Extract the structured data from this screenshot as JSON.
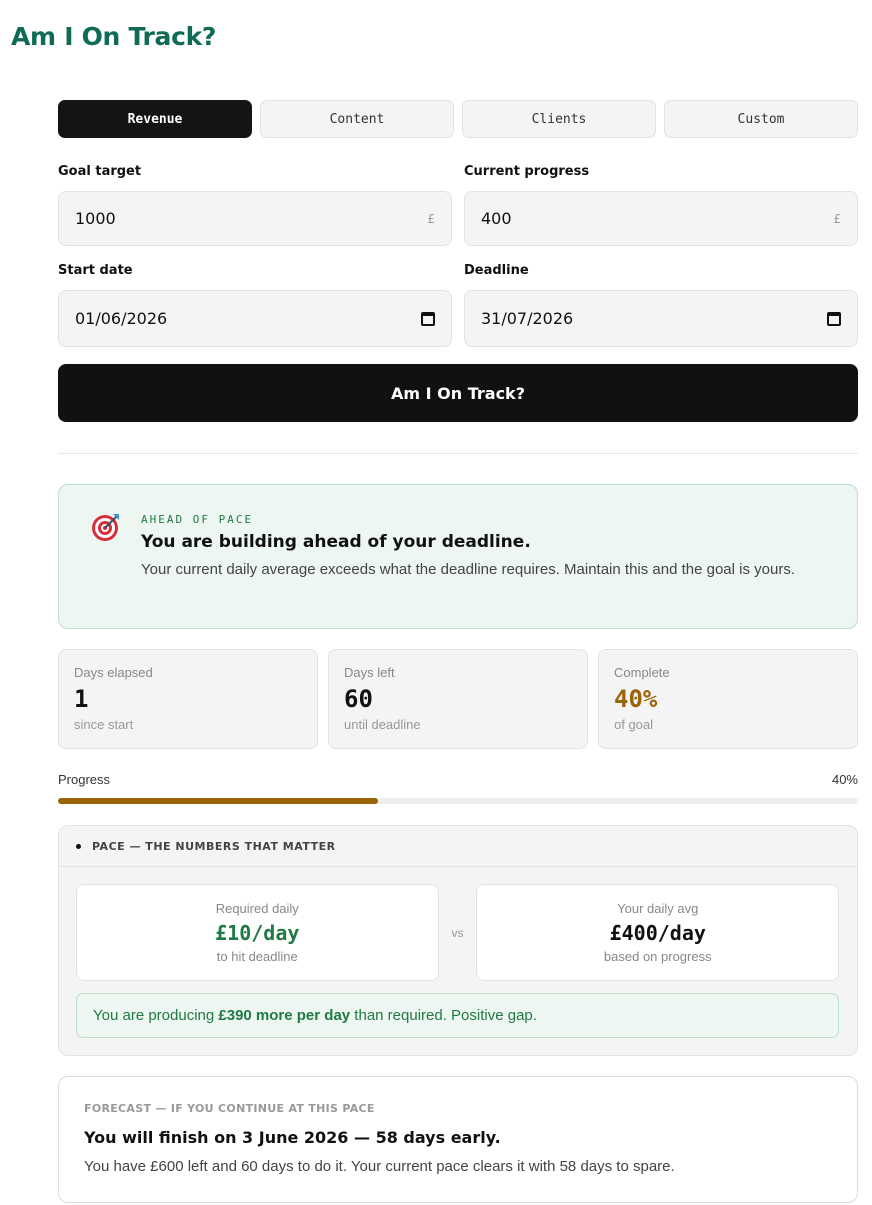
{
  "app": {
    "title": "Am I On Track?"
  },
  "tabs": [
    {
      "label": "Revenue",
      "active": true
    },
    {
      "label": "Content",
      "active": false
    },
    {
      "label": "Clients",
      "active": false
    },
    {
      "label": "Custom",
      "active": false
    }
  ],
  "form": {
    "goal_target": {
      "label": "Goal target",
      "value": "1000",
      "suffix": "£"
    },
    "current_progress": {
      "label": "Current progress",
      "value": "400",
      "suffix": "£"
    },
    "start_date": {
      "label": "Start date",
      "value": "01/06/2026"
    },
    "deadline": {
      "label": "Deadline",
      "value": "31/07/2026"
    },
    "submit_label": "Am I On Track?"
  },
  "status": {
    "icon": "target-icon",
    "eyebrow": "AHEAD OF PACE",
    "title": "You are building ahead of your deadline.",
    "body": "Your current daily average exceeds what the deadline requires. Maintain this and the goal is yours.",
    "accent": "#1f7a44"
  },
  "stats": [
    {
      "label": "Days elapsed",
      "value": "1",
      "sub": "since start"
    },
    {
      "label": "Days left",
      "value": "60",
      "sub": "until deadline"
    },
    {
      "label": "Complete",
      "value": "40%",
      "sub": "of goal"
    }
  ],
  "progress": {
    "label": "Progress",
    "percent_text": "40%",
    "percent": 40,
    "fill_color": "#9a6408"
  },
  "pace": {
    "heading": "PACE — THE NUMBERS THAT MATTER",
    "required": {
      "label": "Required daily",
      "value": "£10/day",
      "sub": "to hit deadline"
    },
    "vs": "vs",
    "average": {
      "label": "Your daily avg",
      "value": "£400/day",
      "sub": "based on progress"
    },
    "note_prefix": "You are producing ",
    "note_bold": "£390 more per day",
    "note_suffix": " than required. Positive gap."
  },
  "forecast": {
    "eyebrow": "FORECAST — IF YOU CONTINUE AT THIS PACE",
    "title": "You will finish on 3 June 2026 — 58 days early.",
    "body": "You have £600 left and 60 days to do it. Your current pace clears it with 58 days to spare."
  }
}
